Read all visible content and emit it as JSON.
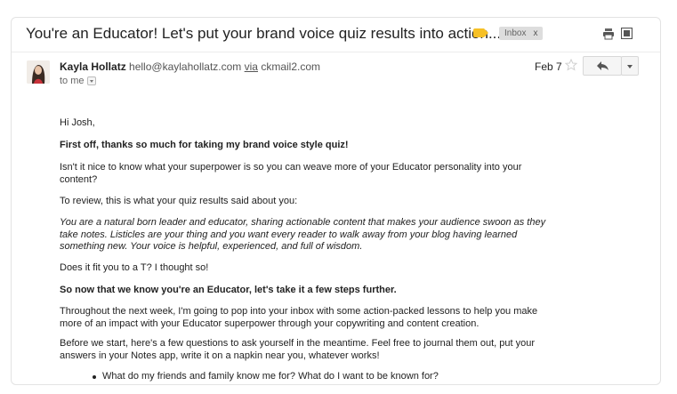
{
  "email": {
    "subject": "You're an Educator! Let's put your brand voice quiz results into action...",
    "label_chip": "Inbox",
    "label_chip_close": "x",
    "sender_name": "Kayla Hollatz",
    "sender_email": "hello@kaylahollatz.com",
    "via_word": "via",
    "via_domain": "ckmail2.com",
    "to_line": "to me",
    "date": "Feb 7",
    "colors": {
      "label_tag": "#f6c026",
      "chip_bg": "#dddddd"
    },
    "icons": [
      "important-label-icon",
      "print-icon",
      "new-window-icon",
      "star-icon",
      "reply-icon",
      "more-options-icon"
    ]
  },
  "body": {
    "greeting": "Hi Josh,",
    "p1": "First off, thanks so much for taking my brand voice style quiz!",
    "p2": "Isn't it nice to know what your superpower is so you can weave more of your Educator personality into your content?",
    "p3": "To review, this is what your quiz results said about you:",
    "p4": "You are a natural born leader and educator, sharing actionable content that makes your audience swoon as they take notes. Listicles are your thing and you want every reader to walk away from your blog having learned something new. Your voice is helpful, experienced, and full of wisdom.",
    "p5": "Does it fit you to a T? I thought so!",
    "p6": "So now that we know you're an Educator, let's take it a few steps further.",
    "p7": "Throughout the next week, I'm going to pop into your inbox with some action-packed lessons to help you make more of an impact with your Educator superpower through your copywriting and content creation.",
    "p8": "Before we start, here's a few questions to ask yourself in the meantime. Feel free to journal them out, put your answers in your Notes app, write it on a napkin near you, whatever works!",
    "bullets": [
      "What do my friends and family know me for? What do I want to be known for?"
    ]
  }
}
